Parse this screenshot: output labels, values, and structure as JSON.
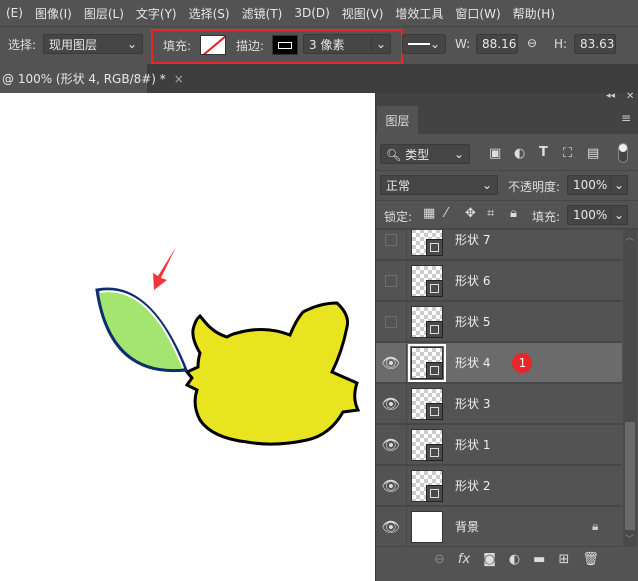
{
  "menu": [
    "(E)",
    "图像(I)",
    "图层(L)",
    "文字(Y)",
    "选择(S)",
    "滤镜(T)",
    "3D(D)",
    "视图(V)",
    "增效工具",
    "窗口(W)",
    "帮助(H)"
  ],
  "options": {
    "select_label": "选择:",
    "select_value": "现用图层",
    "fill_label": "填充:",
    "stroke_label": "描边:",
    "stroke_width": "3 像素",
    "w_label": "W:",
    "w_value": "88.16",
    "h_label": "H:",
    "h_value": "83.63",
    "highlight_color": "#e8262b"
  },
  "doc_tab": {
    "title": "@ 100% (形状 4, RGB/8#) *",
    "close": "×"
  },
  "canvas": {
    "leaf_color": "#a3e56e",
    "body_color": "#e8e41f",
    "arrow_color": "#f0373a"
  },
  "layers_panel": {
    "title": "图层",
    "filter_label": "类型",
    "blend_mode": "正常",
    "opacity_label": "不透明度:",
    "opacity": "100%",
    "lock_label": "锁定:",
    "fill_label": "填充:",
    "fill": "100%",
    "layers": [
      {
        "name": "形状 7",
        "visible": false
      },
      {
        "name": "形状 6",
        "visible": false
      },
      {
        "name": "形状 5",
        "visible": false
      },
      {
        "name": "形状 4",
        "visible": true,
        "selected": true,
        "marker": "1"
      },
      {
        "name": "形状 3",
        "visible": true
      },
      {
        "name": "形状 1",
        "visible": true
      },
      {
        "name": "形状 2",
        "visible": true
      },
      {
        "name": "背景",
        "visible": true,
        "locked": true
      }
    ]
  }
}
